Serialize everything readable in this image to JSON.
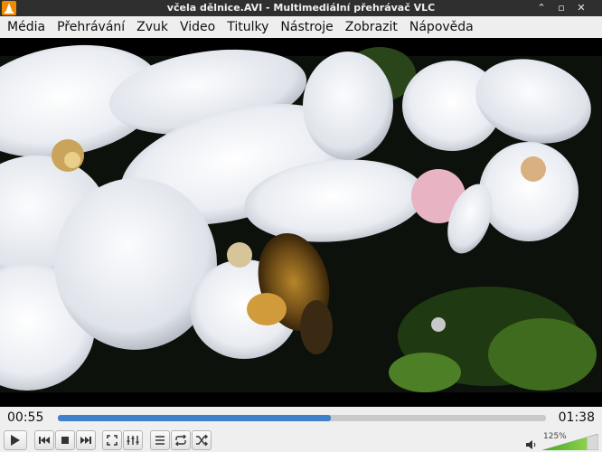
{
  "window": {
    "title": "včela dělnice.AVI - Multimediální přehrávač VLC",
    "minimize_glyph": "⌃",
    "maximize_glyph": "▫",
    "close_glyph": "✕"
  },
  "menu": {
    "items": [
      {
        "label": "Média"
      },
      {
        "label": "Přehrávání"
      },
      {
        "label": "Zvuk"
      },
      {
        "label": "Video"
      },
      {
        "label": "Titulky"
      },
      {
        "label": "Nástroje"
      },
      {
        "label": "Zobrazit"
      },
      {
        "label": "Nápověda"
      }
    ]
  },
  "playback": {
    "elapsed": "00:55",
    "total": "01:38",
    "progress_fraction": 0.56
  },
  "volume": {
    "percent_label": "125%",
    "level_fraction": 0.8
  },
  "icons": {
    "app": "vlc-cone-icon",
    "play": "play-icon",
    "previous": "skip-previous-icon",
    "stop": "stop-icon",
    "next": "skip-next-icon",
    "fullscreen": "fullscreen-icon",
    "extended": "equalizer-icon",
    "playlist": "playlist-icon",
    "loop": "loop-icon",
    "shuffle": "shuffle-icon",
    "volume": "speaker-icon"
  },
  "colors": {
    "accent": "#3f7fcc",
    "vlc_orange": "#f08a00",
    "volume_green": "#4caf30"
  }
}
